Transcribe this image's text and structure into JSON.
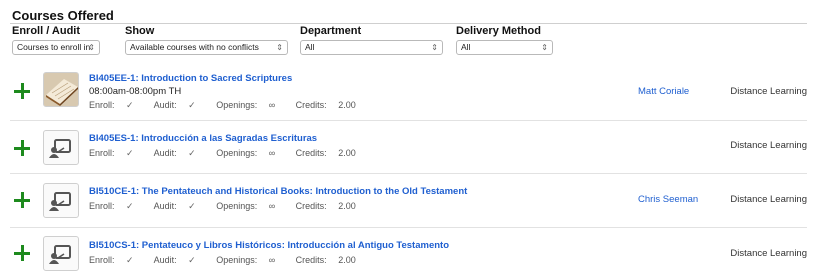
{
  "page": {
    "title": "Courses Offered"
  },
  "filters": {
    "enroll_audit": {
      "label": "Enroll / Audit",
      "value": "Courses to enroll in"
    },
    "show": {
      "label": "Show",
      "value": "Available courses with no conflicts"
    },
    "department": {
      "label": "Department",
      "value": "All"
    },
    "delivery_method": {
      "label": "Delivery Method",
      "value": "All"
    }
  },
  "icons": {
    "add": "plus-icon",
    "thumbnail_placeholder": "presentation-icon",
    "select_arrow": "sort-arrows-icon",
    "check": "checkmark-icon"
  },
  "colors": {
    "add": "#1d8a1d",
    "link": "#1f5fd0"
  },
  "meta_labels": {
    "enroll": "Enroll:",
    "audit": "Audit:",
    "openings": "Openings:",
    "credits": "Credits:"
  },
  "symbols": {
    "check": "✓",
    "infinity": "∞",
    "sort": "⇕"
  },
  "courses": [
    {
      "title": "BI405EE-1: Introduction to Sacred Scriptures",
      "time": "08:00am-08:00pm TH",
      "credits": "2.00",
      "instructor": "Matt Coriale",
      "delivery": "Distance Learning",
      "thumb": "photo"
    },
    {
      "title": "BI405ES-1: Introducción a las Sagradas Escrituras",
      "time": "",
      "credits": "2.00",
      "instructor": "",
      "delivery": "Distance Learning",
      "thumb": "placeholder"
    },
    {
      "title": "BI510CE-1: The Pentateuch and Historical Books: Introduction to the Old Testament",
      "time": "",
      "credits": "2.00",
      "instructor": "Chris Seeman",
      "delivery": "Distance Learning",
      "thumb": "placeholder"
    },
    {
      "title": "BI510CS-1: Pentateuco y Libros Históricos: Introducción al Antiguo Testamento",
      "time": "",
      "credits": "2.00",
      "instructor": "",
      "delivery": "Distance Learning",
      "thumb": "placeholder"
    }
  ]
}
